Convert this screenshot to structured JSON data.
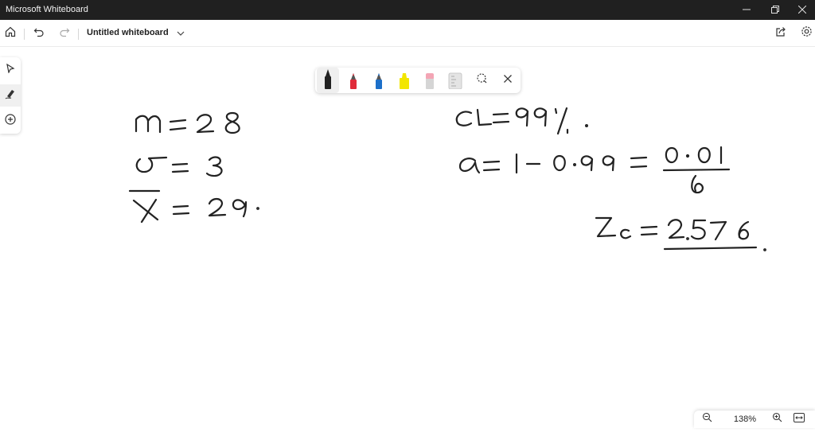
{
  "window": {
    "title": "Microsoft Whiteboard"
  },
  "toolbar": {
    "board_title": "Untitled whiteboard",
    "icons": [
      "home-icon",
      "undo-icon",
      "redo-icon",
      "chevron-down-icon",
      "share-icon",
      "gear-icon"
    ]
  },
  "left_rail": {
    "tools": [
      "select-icon",
      "pen-icon",
      "add-icon"
    ],
    "active": "pen-icon"
  },
  "ink_toolbar": {
    "tools": [
      "black-pen",
      "red-pen",
      "blue-pen",
      "yellow-highlighter",
      "pink-eraser",
      "ruler",
      "lasso-select",
      "close"
    ],
    "selected": "black-pen",
    "colors": {
      "black": "#222222",
      "red": "#e02b3a",
      "blue": "#1c6fc9",
      "yellow": "#f2e600",
      "pink": "#f3a5b5",
      "ruler": "#d9d9d9"
    }
  },
  "zoom": {
    "level": "138%"
  },
  "colors": {
    "titlebar_bg": "#202020",
    "canvas_bg": "#ffffff",
    "ink": "#222222"
  }
}
